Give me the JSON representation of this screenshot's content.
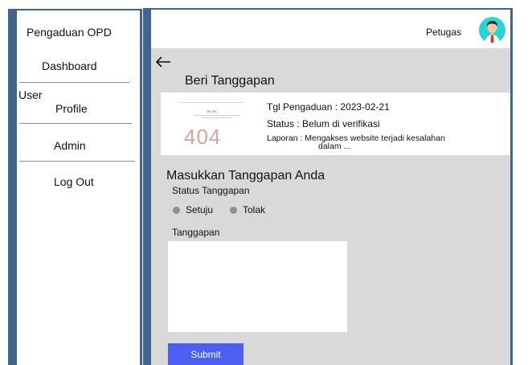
{
  "sidebar": {
    "title": "Pengaduan OPD",
    "items": [
      {
        "label": "Dashboard"
      },
      {
        "label_line1": "User",
        "label_line2": "Profile"
      },
      {
        "label": "Admin"
      },
      {
        "label": "Log Out"
      }
    ]
  },
  "header": {
    "user_role": "Petugas",
    "avatar_icon": "user-avatar-icon"
  },
  "page": {
    "back_icon": "arrow-left-icon",
    "title": "Beri Tanggapan"
  },
  "complaint": {
    "thumbnail": {
      "oops_text": "Oh Oh...",
      "error_code": "404"
    },
    "date": "Tgl Pengaduan : 2023-02-21",
    "status": "Status : Belum di verifikasi",
    "report_line1": "Laporan : Mengakses website terjadi kesalahan",
    "report_line2": "dalam ..."
  },
  "form": {
    "heading": "Masukkan Tanggapan Anda",
    "status_label": "Status Tanggapan",
    "options": [
      {
        "label": "Setuju"
      },
      {
        "label": "Tolak"
      }
    ],
    "response_label": "Tanggapan",
    "response_value": "",
    "submit_label": "Submit"
  },
  "colors": {
    "frame": "#41658c",
    "content_bg": "#d9d9d9",
    "submit": "#4d5ff0",
    "avatar_bg": "#2ad3d8",
    "radio": "#8f8f8f"
  }
}
